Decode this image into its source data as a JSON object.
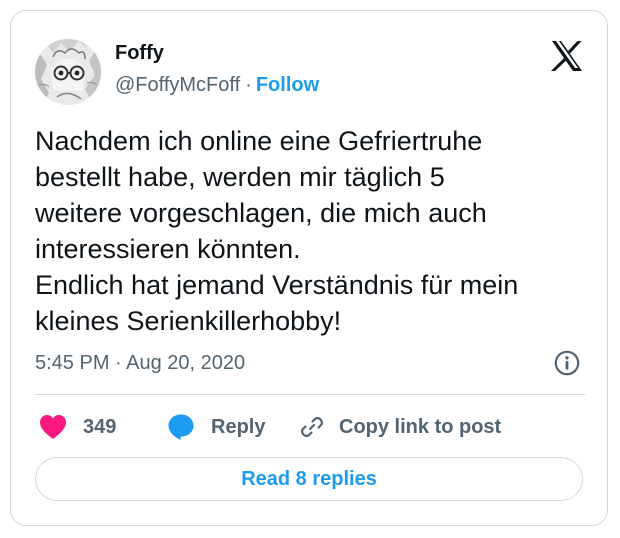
{
  "tweet": {
    "author_name": "Foffy",
    "author_handle": "@FoffyMcFoff",
    "separator": "·",
    "follow_label": "Follow",
    "text": "Nachdem ich online eine Gefriertruhe\nbestellt habe, werden mir täglich 5\nweitere vorgeschlagen, die mich auch\ninteressieren könnten.\nEndlich hat jemand Verständnis für mein\nkleines Serienkillerhobby!",
    "timestamp": "5:45 PM · Aug 20, 2020"
  },
  "actions": {
    "like_count": "349",
    "reply_label": "Reply",
    "copy_link_label": "Copy link to post"
  },
  "replies_button_label": "Read 8 replies",
  "icons": {
    "brand": "x-logo-icon",
    "like": "heart-icon",
    "reply": "speech-bubble-icon",
    "copy": "link-icon",
    "info": "info-icon"
  },
  "colors": {
    "accent": "#1d9bf0",
    "like": "#f91880",
    "text": "#0f1419",
    "secondary_text": "#536471",
    "border": "#cfd9de"
  }
}
